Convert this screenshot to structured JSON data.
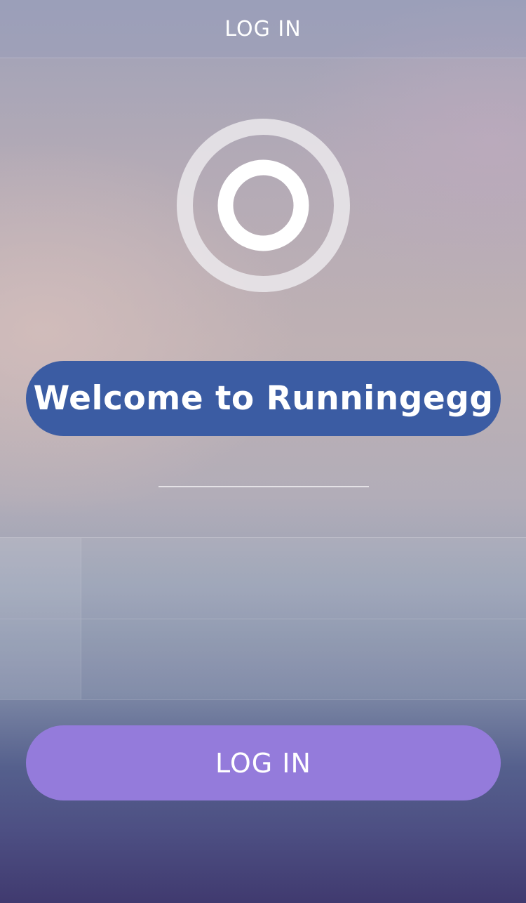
{
  "header": {
    "title": "LOG IN"
  },
  "logo": {
    "icon": "concentric-rings-logo-icon"
  },
  "welcome_banner": {
    "text": "Welcome to Runningegg",
    "color": "#3b5ca3"
  },
  "form": {
    "rows": [
      {
        "icon": "user-icon",
        "value": ""
      },
      {
        "icon": "lock-icon",
        "value": ""
      }
    ]
  },
  "login_button": {
    "label": "LOG IN",
    "color": "#947bdb"
  }
}
